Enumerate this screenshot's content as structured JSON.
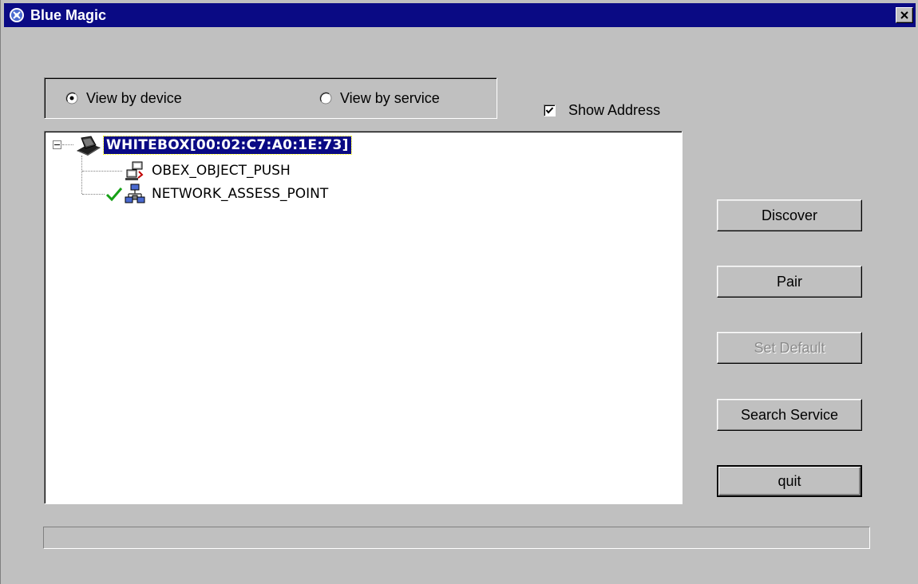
{
  "window": {
    "title": "Blue Magic"
  },
  "view_mode": {
    "options": [
      {
        "label": "View by device",
        "selected": true
      },
      {
        "label": "View by service",
        "selected": false
      }
    ]
  },
  "show_address": {
    "label": "Show Address",
    "checked": true
  },
  "tree": {
    "root": {
      "label": "WHITEBOX[00:02:C7:A0:1E:73]",
      "icon": "laptop-icon",
      "expanded": true,
      "selected": true
    },
    "children": [
      {
        "label": "OBEX_OBJECT_PUSH",
        "icon": "obex-push-icon",
        "checked": false
      },
      {
        "label": "NETWORK_ASSESS_POINT",
        "icon": "network-icon",
        "checked": true
      }
    ]
  },
  "buttons": {
    "discover": "Discover",
    "pair": "Pair",
    "set_default": "Set Default",
    "search_service": "Search Service",
    "quit": "quit"
  },
  "progress": {
    "value": 0
  },
  "colors": {
    "titlebar": "#0a0a84",
    "face": "#c0c0c0",
    "selection": "#0a0a84",
    "check": "#16a016"
  }
}
